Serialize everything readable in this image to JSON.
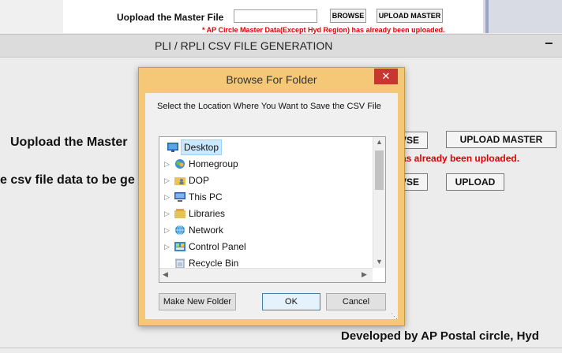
{
  "background": {
    "top_label": "Uopload the Master File",
    "top_browse": "BROWSE",
    "top_upload": "UPLOAD MASTER",
    "top_red_note": "* AP Circle Master Data(Except Hyd Region) has already been uploaded.",
    "window_title": "PLI / RPLI CSV FILE GENERATION",
    "minimize": "−",
    "label_master": "Uopload the Master",
    "label_csv": "e csv file data to be ge",
    "btn_browse_1": "VSE",
    "btn_upload_master": "UPLOAD MASTER",
    "red_msg": "as already been uploaded.",
    "btn_browse_2": "VSE",
    "btn_upload": "UPLOAD",
    "footer": "Developed by AP Postal circle, Hyd"
  },
  "dialog": {
    "title": "Browse For Folder",
    "close": "✕",
    "instruction": "Select the Location Where You Want to Save the CSV File",
    "tree": [
      {
        "label": "Desktop",
        "icon": "desktop-icon",
        "selected": true
      },
      {
        "label": "Homegroup",
        "icon": "homegroup-icon",
        "selected": false
      },
      {
        "label": "DOP",
        "icon": "user-folder-icon",
        "selected": false
      },
      {
        "label": "This PC",
        "icon": "computer-icon",
        "selected": false
      },
      {
        "label": "Libraries",
        "icon": "libraries-icon",
        "selected": false
      },
      {
        "label": "Network",
        "icon": "network-icon",
        "selected": false
      },
      {
        "label": "Control Panel",
        "icon": "control-panel-icon",
        "selected": false
      },
      {
        "label": "Recycle Bin",
        "icon": "recycle-bin-icon",
        "selected": false
      }
    ],
    "make_new_folder": "Make New Folder",
    "ok": "OK",
    "cancel": "Cancel"
  }
}
